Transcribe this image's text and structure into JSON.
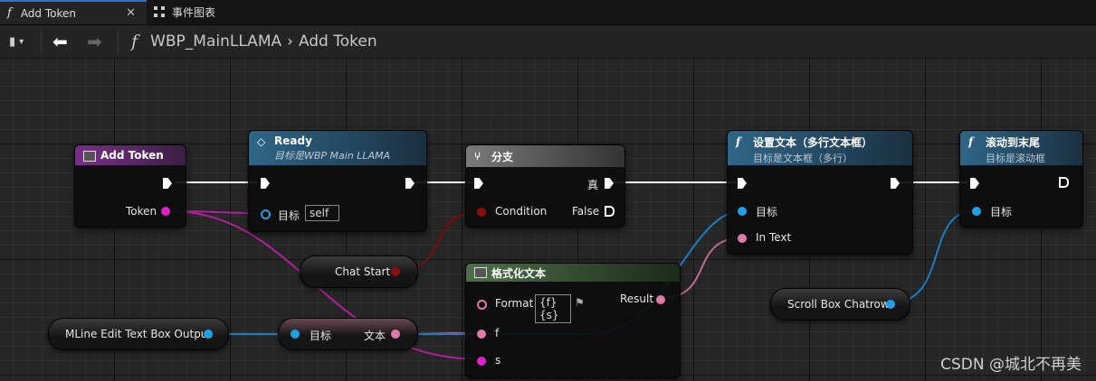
{
  "tabs": [
    {
      "label": "Add Token",
      "active": true
    },
    {
      "label": "事件图表",
      "active": false
    }
  ],
  "breadcrumb": {
    "graph": "WBP_MainLLAMA",
    "function": "Add Token"
  },
  "nodes": {
    "add_token": {
      "title": "Add Token",
      "pin_token": "Token"
    },
    "ready": {
      "title": "Ready",
      "subtitle": "目标是WBP Main LLAMA",
      "pin_target": "目标",
      "target_value": "self"
    },
    "branch": {
      "title": "分支",
      "pin_condition": "Condition",
      "pin_true": "真",
      "pin_false": "False"
    },
    "set_text": {
      "title": "设置文本（多行文本框）",
      "subtitle": "目标是文本框（多行）",
      "pin_target": "目标",
      "pin_in_text": "In Text"
    },
    "scroll_end": {
      "title": "滚动到末尾",
      "subtitle": "目标是滚动框",
      "pin_target": "目标"
    },
    "chat_start": {
      "label": "Chat Start"
    },
    "format_text": {
      "title": "格式化文本",
      "pin_format": "Format",
      "format_value": "{f}{s}",
      "pin_result": "Result",
      "pin_f": "f",
      "pin_s": "s"
    },
    "mline_output": {
      "label": "MLine Edit Text Box Output"
    },
    "get_text": {
      "pin_target": "目标",
      "pin_text": "文本"
    },
    "scroll_box": {
      "label": "Scroll Box Chatrow"
    }
  },
  "colors": {
    "exec": "#ffffff",
    "object": "#1fa0e6",
    "text": "#e07aa8",
    "string": "#e020c8",
    "bool": "#8a0f0f",
    "function_header": "#2b5f8c",
    "event_header": "#6a2a7a",
    "branch_header": "#6a6a6a",
    "format_header": "#3f5f3a"
  },
  "watermark": "CSDN @城北不再美"
}
